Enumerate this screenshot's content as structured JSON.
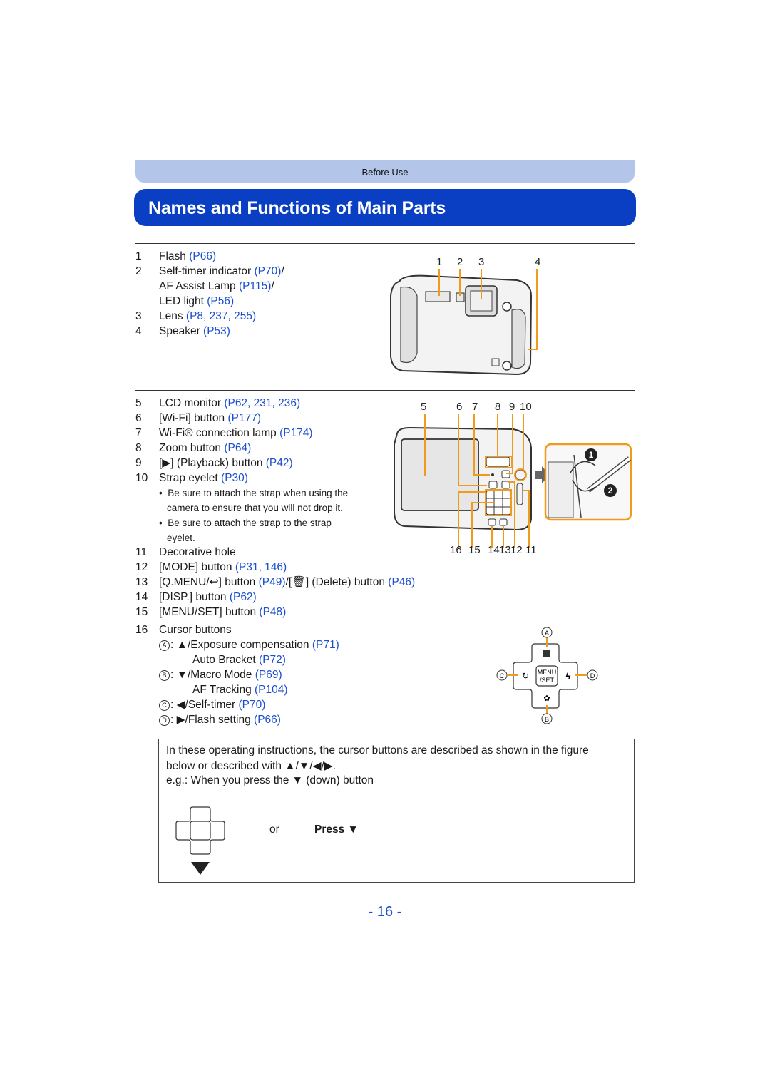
{
  "header": {
    "section": "Before Use",
    "title": "Names and Functions of Main Parts"
  },
  "front_parts": [
    {
      "num": "1",
      "label": "Flash ",
      "ref": "(P66)"
    },
    {
      "num": "2",
      "label": "Self-timer indicator ",
      "ref": "(P70)",
      "suffix": "/"
    },
    {
      "num": "",
      "label": "AF Assist Lamp ",
      "ref": "(P115)",
      "suffix": "/"
    },
    {
      "num": "",
      "label": "LED light ",
      "ref": "(P56)"
    },
    {
      "num": "3",
      "label": "Lens ",
      "ref": "(P8, 237, 255)"
    },
    {
      "num": "4",
      "label": "Speaker ",
      "ref": "(P53)"
    }
  ],
  "front_callouts": [
    "1",
    "2",
    "3",
    "4"
  ],
  "rear_parts": [
    {
      "num": "5",
      "label": "LCD monitor ",
      "ref": "(P62, 231, 236)"
    },
    {
      "num": "6",
      "label": "[Wi-Fi] button ",
      "ref": "(P177)"
    },
    {
      "num": "7",
      "label": "Wi-Fi® connection lamp ",
      "ref": "(P174)"
    },
    {
      "num": "8",
      "label": "Zoom button ",
      "ref": "(P64)"
    },
    {
      "num": "9",
      "label": "[▶] (Playback) button ",
      "ref": "(P42)"
    },
    {
      "num": "10",
      "label": "Strap eyelet ",
      "ref": "(P30)"
    }
  ],
  "strap_notes": [
    "Be sure to attach the strap when using the",
    "camera to ensure that you will not drop it.",
    "Be sure to attach the strap to the strap",
    "eyelet."
  ],
  "rear_parts_2": [
    {
      "num": "11",
      "label": "Decorative hole",
      "ref": ""
    },
    {
      "num": "12",
      "label": "[MODE] button ",
      "ref": "(P31, 146)"
    },
    {
      "num": "13",
      "label": "[Q.MENU/↩] button ",
      "ref": "(P49)",
      "mid": "/[🗑] (Delete) button ",
      "ref2": "(P46)"
    },
    {
      "num": "14",
      "label": "[DISP.] button ",
      "ref": "(P62)"
    },
    {
      "num": "15",
      "label": "[MENU/SET] button ",
      "ref": "(P48)"
    }
  ],
  "rear_callouts_top": [
    "5",
    "6",
    "7",
    "8",
    "9",
    "10"
  ],
  "rear_callouts_bottom": [
    "16",
    "15",
    "14",
    "13",
    "12",
    "11"
  ],
  "strap_steps": [
    "1",
    "2"
  ],
  "cursor": {
    "num": "16",
    "title": "Cursor buttons",
    "entries": [
      {
        "key": "A",
        "text": ": ▲/Exposure compensation ",
        "ref": "(P71)"
      },
      {
        "key": "",
        "text": "Auto Bracket ",
        "ref": "(P72)"
      },
      {
        "key": "B",
        "text": ": ▼/Macro Mode ",
        "ref": "(P69)"
      },
      {
        "key": "",
        "text": "AF Tracking ",
        "ref": "(P104)"
      },
      {
        "key": "C",
        "text": ": ◀/Self-timer ",
        "ref": "(P70)"
      },
      {
        "key": "D",
        "text": ": ▶/Flash setting ",
        "ref": "(P66)"
      }
    ],
    "diagram_labels": {
      "a": "A",
      "b": "B",
      "c": "C",
      "d": "D",
      "center_top": "MENU",
      "center_bottom": "/SET"
    }
  },
  "info_box": {
    "line1": "In these operating instructions, the cursor buttons are described as shown in the figure",
    "line2": "below or described with ▲/▼/◀/▶.",
    "line3": "e.g.: When you press the ▼ (down) button",
    "or": "or",
    "press": "Press ▼"
  },
  "page": {
    "number": "- 16 -"
  },
  "colors": {
    "title_bg": "#0a3fc4",
    "section_bg": "#b3c6ea",
    "link": "#1b4fd0",
    "callout": "#f29a1b"
  }
}
